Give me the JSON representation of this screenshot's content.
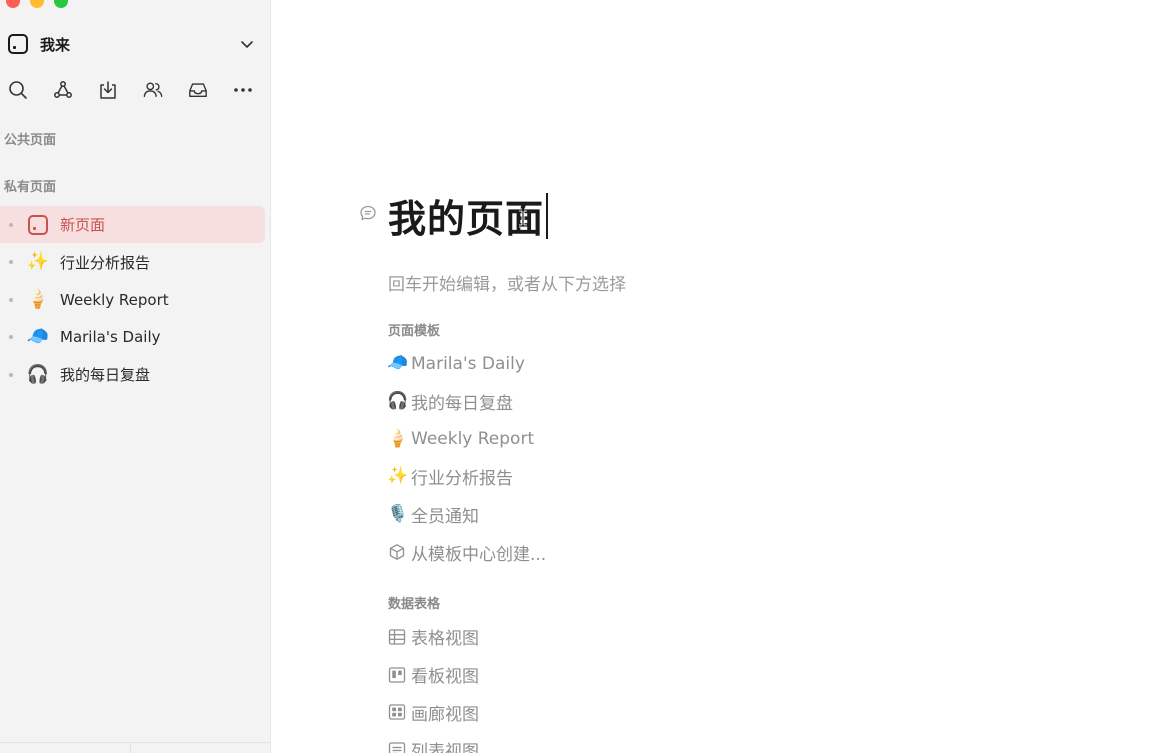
{
  "window": {
    "traffic_lights": [
      "#ff5f57",
      "#febc2e",
      "#28c840"
    ]
  },
  "sidebar": {
    "workspace_name": "我来",
    "toolbar_icons": [
      "search-icon",
      "share-network-icon",
      "download-icon",
      "members-icon",
      "inbox-icon",
      "more-icon"
    ],
    "public_section_label": "公共页面",
    "private_section_label": "私有页面",
    "items": [
      {
        "icon": "page-icon",
        "label": "新页面",
        "active": true
      },
      {
        "icon": "✨",
        "label": "行业分析报告",
        "active": false
      },
      {
        "icon": "🍦",
        "label": "Weekly Report",
        "active": false
      },
      {
        "icon": "🧢",
        "label": "Marila's Daily",
        "active": false
      },
      {
        "icon": "🎧",
        "label": "我的每日复盘",
        "active": false
      }
    ],
    "active_color": "#c9514f",
    "active_bg": "#f7dfdf"
  },
  "main": {
    "title": "我的页面",
    "hint": "回车开始编辑，或者从下方选择",
    "templates_label": "页面模板",
    "templates": [
      {
        "icon": "🧢",
        "label": "Marila's Daily"
      },
      {
        "icon": "🎧",
        "label": "我的每日复盘"
      },
      {
        "icon": "🍦",
        "label": "Weekly Report"
      },
      {
        "icon": "✨",
        "label": "行业分析报告"
      },
      {
        "icon": "🎙️",
        "label": "全员通知"
      },
      {
        "icon": "cube-icon",
        "label": "从模板中心创建..."
      }
    ],
    "tables_label": "数据表格",
    "tables": [
      {
        "icon": "table-view-icon",
        "label": "表格视图"
      },
      {
        "icon": "kanban-view-icon",
        "label": "看板视图"
      },
      {
        "icon": "gallery-view-icon",
        "label": "画廊视图"
      },
      {
        "icon": "list-view-icon",
        "label": "列表视图"
      }
    ]
  }
}
